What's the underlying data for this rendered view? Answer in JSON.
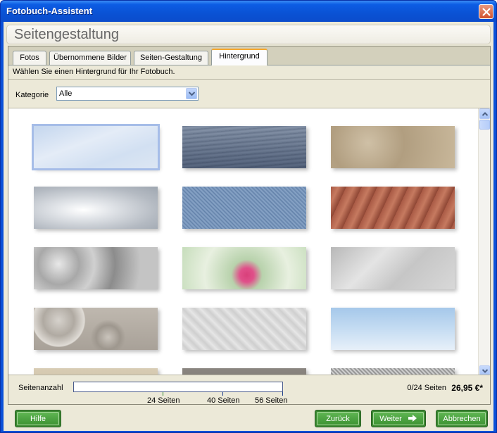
{
  "window": {
    "title": "Fotobuch-Assistent"
  },
  "header": {
    "title": "Seitengestaltung"
  },
  "tabs": [
    {
      "label": "Fotos",
      "active": false
    },
    {
      "label": "Übernommene Bilder",
      "active": false
    },
    {
      "label": "Seiten-Gestaltung",
      "active": false
    },
    {
      "label": "Hintergrund",
      "active": true
    }
  ],
  "instruction": "Wählen Sie einen Hintergrund für Ihr Fotobuch.",
  "category": {
    "label": "Kategorie",
    "value": "Alle"
  },
  "backgrounds": [
    {
      "name": "sky-light",
      "selected": true
    },
    {
      "name": "water",
      "selected": false
    },
    {
      "name": "sand",
      "selected": false
    },
    {
      "name": "clouds-sun",
      "selected": false
    },
    {
      "name": "denim",
      "selected": false
    },
    {
      "name": "soil-furrows",
      "selected": false
    },
    {
      "name": "leaves-grey",
      "selected": false
    },
    {
      "name": "roses",
      "selected": false
    },
    {
      "name": "brushed-metal",
      "selected": false
    },
    {
      "name": "gravel",
      "selected": false
    },
    {
      "name": "quilted-pattern",
      "selected": false
    },
    {
      "name": "blue-sky",
      "selected": false
    },
    {
      "name": "texture-beige",
      "selected": false
    },
    {
      "name": "texture-grey",
      "selected": false
    },
    {
      "name": "metal-plate",
      "selected": false
    }
  ],
  "pages": {
    "label": "Seitenanzahl",
    "count": "0/24 Seiten",
    "price": "26,95 €*",
    "ticks": [
      "24 Seiten",
      "40 Seiten",
      "56 Seiten"
    ]
  },
  "buttons": {
    "help": "Hilfe",
    "back": "Zurück",
    "next": "Weiter",
    "cancel": "Abbrechen"
  },
  "colors": {
    "titlebar": "#0a52d4",
    "button_green": "#3e9434",
    "tab_accent": "#f6a72c",
    "tick_green": "#2e8b2e",
    "tick_blue": "#1a3c8c"
  }
}
